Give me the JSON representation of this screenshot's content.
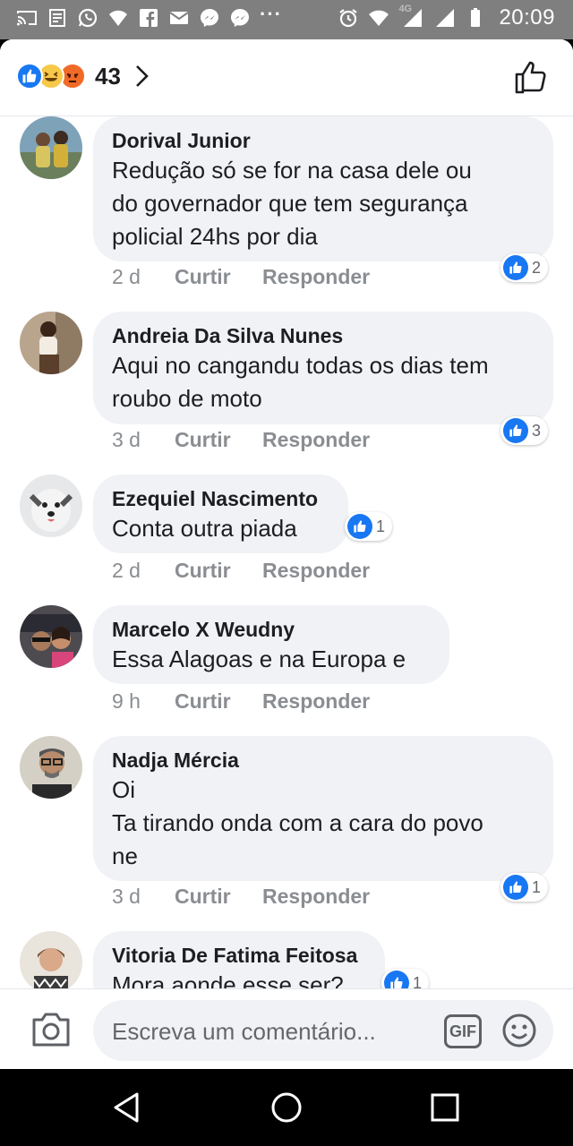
{
  "status_bar": {
    "time": "20:09",
    "network": "4G",
    "icons": [
      "cast-icon",
      "reader-icon",
      "whatsapp-icon",
      "shield-wifi-icon",
      "facebook-icon",
      "mail-icon",
      "messenger-icon",
      "messenger-icon",
      "more-dots-icon",
      "alarm-icon",
      "wifi-icon",
      "signal-icon",
      "signal-icon",
      "battery-icon"
    ]
  },
  "header": {
    "reactions": [
      "like",
      "haha",
      "angry"
    ],
    "reaction_count": "43"
  },
  "comments": [
    {
      "author": "Dorival Junior",
      "text": "Redução só se for na casa dele ou\ndo governador que tem segurança\npolicial 24hs por dia",
      "time": "2 d",
      "like_label": "Curtir",
      "reply_label": "Responder",
      "likes": "2"
    },
    {
      "author": "Andreia Da Silva Nunes",
      "text": "Aqui no cangandu todas os dias tem\nroubo de moto",
      "time": "3 d",
      "like_label": "Curtir",
      "reply_label": "Responder",
      "likes": "3"
    },
    {
      "author": "Ezequiel Nascimento",
      "text": "Conta  outra  piada",
      "time": "2 d",
      "like_label": "Curtir",
      "reply_label": "Responder",
      "likes": "1"
    },
    {
      "author": "Marcelo X Weudny",
      "text": "Essa Alagoas e na Europa e",
      "time": "9 h",
      "like_label": "Curtir",
      "reply_label": "Responder",
      "likes": ""
    },
    {
      "author": "Nadja Mércia",
      "text": "Oi\nTa tirando onda com a cara do povo\nne",
      "time": "3 d",
      "like_label": "Curtir",
      "reply_label": "Responder",
      "likes": "1"
    },
    {
      "author": "Vitoria De Fatima Feitosa",
      "text": "Mora aonde esse ser?",
      "time": "",
      "like_label": "",
      "reply_label": "",
      "likes": "1"
    }
  ],
  "composer": {
    "placeholder": "Escreva um comentário...",
    "gif_label": "GIF"
  },
  "colors": {
    "facebook_blue": "#1877f2",
    "bubble_bg": "#f0f2f5",
    "status_bar": "#7f7f7f",
    "meta_gray": "#8a8d91"
  }
}
